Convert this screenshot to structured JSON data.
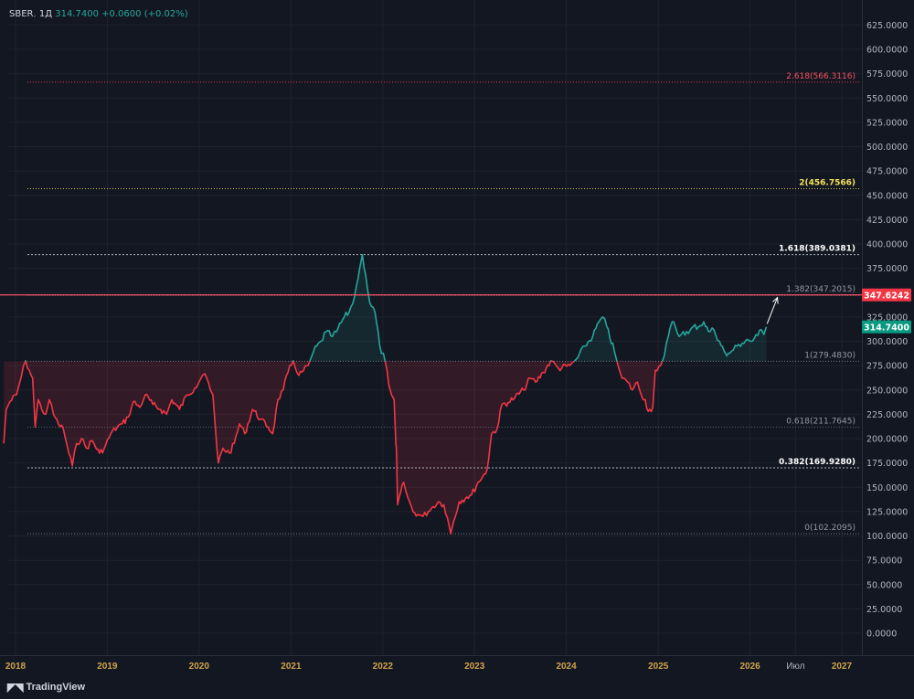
{
  "header": {
    "symbol": "SBER",
    "interval": "1Д",
    "last": "314.7400",
    "change": "+0.0600",
    "change_pct": "(+0.02%)"
  },
  "brand": {
    "name": "TradingView",
    "logo_icon": "tradingview-logo-icon"
  },
  "colors": {
    "background": "#131722",
    "grid": "#1e222d",
    "axis_text": "#b2b5be",
    "axis_year": "#d1a54a",
    "up": "#26a69a",
    "down": "#f23645",
    "resistance": "#f7525f"
  },
  "chart_data": {
    "type": "line",
    "title": "SBER, 1Д",
    "xlabel": "",
    "ylabel": "",
    "grid": true,
    "ylim": [
      -10,
      637.5
    ],
    "xlim": [
      "2017-11-15",
      "2027-02-15"
    ],
    "y_ticks": [
      "0.0000",
      "25.0000",
      "50.0000",
      "75.0000",
      "100.0000",
      "125.0000",
      "150.0000",
      "175.0000",
      "200.0000",
      "225.0000",
      "250.0000",
      "275.0000",
      "300.0000",
      "325.0000",
      "350.0000",
      "375.0000",
      "400.0000",
      "425.0000",
      "450.0000",
      "475.0000",
      "500.0000",
      "525.0000",
      "550.0000",
      "575.0000",
      "600.0000",
      "625.0000"
    ],
    "x_ticks": [
      {
        "label": "2018",
        "date": "2018-01-01"
      },
      {
        "label": "2019",
        "date": "2019-01-01"
      },
      {
        "label": "2020",
        "date": "2020-01-01"
      },
      {
        "label": "2021",
        "date": "2021-01-01"
      },
      {
        "label": "2022",
        "date": "2022-01-01"
      },
      {
        "label": "2023",
        "date": "2023-01-01"
      },
      {
        "label": "2024",
        "date": "2024-01-01"
      },
      {
        "label": "2025",
        "date": "2025-01-01"
      },
      {
        "label": "2026",
        "date": "2026-01-01"
      },
      {
        "label": "Июл",
        "date": "2026-07-01"
      },
      {
        "label": "2027",
        "date": "2027-01-01"
      }
    ],
    "series": [
      {
        "baseline": 279.483,
        "points": [
          [
            "2017-11-15",
            195
          ],
          [
            "2017-11-25",
            230
          ],
          [
            "2017-12-10",
            238
          ],
          [
            "2018-01-05",
            245
          ],
          [
            "2018-01-25",
            265
          ],
          [
            "2018-02-10",
            280
          ],
          [
            "2018-02-25",
            270
          ],
          [
            "2018-03-10",
            262
          ],
          [
            "2018-03-20",
            212
          ],
          [
            "2018-04-01",
            240
          ],
          [
            "2018-04-15",
            230
          ],
          [
            "2018-05-01",
            225
          ],
          [
            "2018-05-15",
            240
          ],
          [
            "2018-06-01",
            225
          ],
          [
            "2018-06-20",
            215
          ],
          [
            "2018-07-10",
            210
          ],
          [
            "2018-08-01",
            185
          ],
          [
            "2018-08-15",
            172
          ],
          [
            "2018-09-01",
            195
          ],
          [
            "2018-09-20",
            200
          ],
          [
            "2018-10-10",
            190
          ],
          [
            "2018-11-01",
            198
          ],
          [
            "2018-12-01",
            185
          ],
          [
            "2018-12-20",
            190
          ],
          [
            "2019-01-15",
            205
          ],
          [
            "2019-02-10",
            212
          ],
          [
            "2019-03-01",
            215
          ],
          [
            "2019-03-25",
            222
          ],
          [
            "2019-04-15",
            238
          ],
          [
            "2019-05-10",
            232
          ],
          [
            "2019-06-01",
            245
          ],
          [
            "2019-07-01",
            235
          ],
          [
            "2019-08-01",
            230
          ],
          [
            "2019-08-25",
            225
          ],
          [
            "2019-09-15",
            240
          ],
          [
            "2019-10-15",
            230
          ],
          [
            "2019-11-15",
            245
          ],
          [
            "2019-12-15",
            252
          ],
          [
            "2020-01-15",
            265
          ],
          [
            "2020-02-01",
            262
          ],
          [
            "2020-02-15",
            250
          ],
          [
            "2020-02-25",
            245
          ],
          [
            "2020-03-12",
            190
          ],
          [
            "2020-03-18",
            175
          ],
          [
            "2020-04-05",
            190
          ],
          [
            "2020-05-01",
            185
          ],
          [
            "2020-05-20",
            195
          ],
          [
            "2020-06-10",
            215
          ],
          [
            "2020-07-01",
            205
          ],
          [
            "2020-08-01",
            230
          ],
          [
            "2020-09-01",
            220
          ],
          [
            "2020-10-01",
            212
          ],
          [
            "2020-10-20",
            205
          ],
          [
            "2020-11-10",
            240
          ],
          [
            "2020-12-01",
            250
          ],
          [
            "2020-12-20",
            268
          ],
          [
            "2021-01-10",
            280
          ],
          [
            "2021-02-01",
            265
          ],
          [
            "2021-02-20",
            270
          ],
          [
            "2021-03-10",
            275
          ],
          [
            "2021-04-01",
            290
          ],
          [
            "2021-05-01",
            300
          ],
          [
            "2021-05-20",
            310
          ],
          [
            "2021-06-15",
            305
          ],
          [
            "2021-07-01",
            310
          ],
          [
            "2021-08-01",
            325
          ],
          [
            "2021-08-20",
            330
          ],
          [
            "2021-09-10",
            345
          ],
          [
            "2021-09-25",
            365
          ],
          [
            "2021-10-01",
            375
          ],
          [
            "2021-10-12",
            389
          ],
          [
            "2021-10-25",
            368
          ],
          [
            "2021-11-10",
            340
          ],
          [
            "2021-12-01",
            330
          ],
          [
            "2021-12-20",
            295
          ],
          [
            "2022-01-10",
            280
          ],
          [
            "2022-01-25",
            255
          ],
          [
            "2022-02-05",
            245
          ],
          [
            "2022-02-15",
            240
          ],
          [
            "2022-02-22",
            195
          ],
          [
            "2022-02-24",
            190
          ],
          [
            "2022-03-01",
            132
          ],
          [
            "2022-03-25",
            155
          ],
          [
            "2022-04-10",
            140
          ],
          [
            "2022-05-01",
            125
          ],
          [
            "2022-05-20",
            122
          ],
          [
            "2022-06-10",
            120
          ],
          [
            "2022-07-01",
            125
          ],
          [
            "2022-07-20",
            130
          ],
          [
            "2022-08-10",
            135
          ],
          [
            "2022-09-01",
            132
          ],
          [
            "2022-09-21",
            112
          ],
          [
            "2022-09-28",
            102.2
          ],
          [
            "2022-10-10",
            115
          ],
          [
            "2022-11-01",
            135
          ],
          [
            "2022-12-01",
            140
          ],
          [
            "2022-12-20",
            142
          ],
          [
            "2023-01-15",
            155
          ],
          [
            "2023-02-01",
            160
          ],
          [
            "2023-02-20",
            168
          ],
          [
            "2023-03-10",
            205
          ],
          [
            "2023-04-01",
            210
          ],
          [
            "2023-04-20",
            235
          ],
          [
            "2023-05-15",
            237
          ],
          [
            "2023-06-10",
            242
          ],
          [
            "2023-07-15",
            250
          ],
          [
            "2023-08-10",
            262
          ],
          [
            "2023-09-01",
            258
          ],
          [
            "2023-10-01",
            268
          ],
          [
            "2023-11-01",
            280
          ],
          [
            "2023-12-01",
            272
          ],
          [
            "2024-01-15",
            275
          ],
          [
            "2024-02-15",
            283
          ],
          [
            "2024-03-15",
            295
          ],
          [
            "2024-04-15",
            305
          ],
          [
            "2024-05-10",
            320
          ],
          [
            "2024-05-25",
            325
          ],
          [
            "2024-06-10",
            315
          ],
          [
            "2024-07-10",
            290
          ],
          [
            "2024-07-25",
            275
          ],
          [
            "2024-08-10",
            262
          ],
          [
            "2024-09-01",
            258
          ],
          [
            "2024-09-20",
            250
          ],
          [
            "2024-10-10",
            258
          ],
          [
            "2024-10-25",
            245
          ],
          [
            "2024-11-10",
            240
          ],
          [
            "2024-11-22",
            228
          ],
          [
            "2024-12-10",
            232
          ],
          [
            "2024-12-20",
            270
          ],
          [
            "2025-01-10",
            275
          ],
          [
            "2025-01-25",
            285
          ],
          [
            "2025-02-10",
            305
          ],
          [
            "2025-02-25",
            320
          ],
          [
            "2025-03-10",
            315
          ],
          [
            "2025-03-25",
            305
          ],
          [
            "2025-04-10",
            310
          ],
          [
            "2025-05-01",
            308
          ],
          [
            "2025-05-20",
            315
          ],
          [
            "2025-06-10",
            315
          ],
          [
            "2025-07-01",
            320
          ],
          [
            "2025-07-20",
            310
          ],
          [
            "2025-08-10",
            312
          ],
          [
            "2025-09-01",
            300
          ],
          [
            "2025-09-20",
            290
          ],
          [
            "2025-10-01",
            285
          ],
          [
            "2025-10-20",
            290
          ],
          [
            "2025-11-10",
            295
          ],
          [
            "2025-12-01",
            298
          ],
          [
            "2025-12-20",
            302
          ],
          [
            "2026-01-10",
            300
          ],
          [
            "2026-02-01",
            306
          ],
          [
            "2026-02-15",
            312
          ],
          [
            "2026-02-25",
            307
          ],
          [
            "2026-03-07",
            314.74
          ]
        ]
      }
    ],
    "fib_levels": [
      {
        "label": "0(102.2095)",
        "value": 102.2095,
        "color": "#787b86",
        "label_color": "#9598a1",
        "dash": [
          1,
          2
        ]
      },
      {
        "label": "0.382(169.9280)",
        "value": 169.928,
        "color": "#b2b5be",
        "label_color": "#ffffff",
        "dash": [
          2,
          2
        ]
      },
      {
        "label": "0.618(211.7645)",
        "value": 211.7645,
        "color": "#5d606b",
        "label_color": "#9598a1",
        "dash": [
          1,
          2
        ]
      },
      {
        "label": "1(279.4830)",
        "value": 279.483,
        "color": "#787b86",
        "label_color": "#9598a1",
        "dash": [
          1,
          2
        ]
      },
      {
        "label": "1.382(347.2015)",
        "value": 347.2015,
        "color": "#787b86",
        "label_color": "#9598a1",
        "dash": [
          1,
          2
        ]
      },
      {
        "label": "1.618(389.0381)",
        "value": 389.0381,
        "color": "#b2b5be",
        "label_color": "#ffffff",
        "dash": [
          2,
          2
        ]
      },
      {
        "label": "2(456.7566)",
        "value": 456.7566,
        "color": "#d4c147",
        "label_color": "#f7e35a",
        "dash": [
          1,
          2
        ]
      },
      {
        "label": "2.618(566.3116)",
        "value": 566.3116,
        "color": "#f23645",
        "label_color": "#f7525f",
        "dash": [
          1,
          2
        ]
      }
    ],
    "price_badges": [
      {
        "label": "347.6242",
        "value": 347.6242,
        "color": "#f23645"
      },
      {
        "label": "314.7400",
        "value": 314.74,
        "color": "#089981"
      }
    ],
    "resistance_line": {
      "value": 347.6242,
      "color": "#f7525f"
    },
    "arrow": {
      "from": [
        "2026-03-10",
        318
      ],
      "to": [
        "2026-04-20",
        345
      ]
    }
  }
}
